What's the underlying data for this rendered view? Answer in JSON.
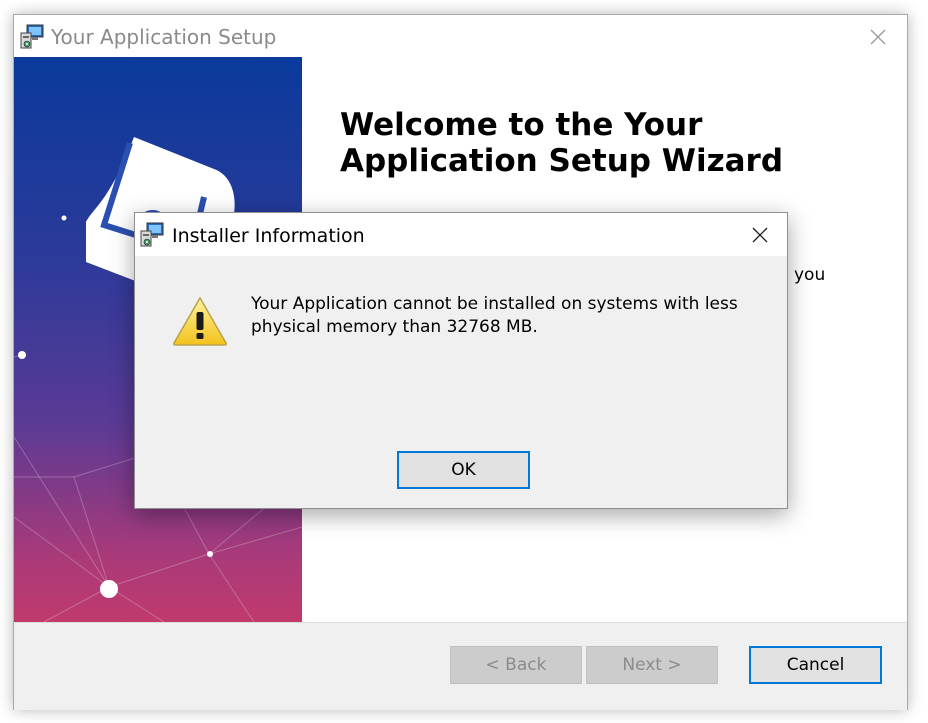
{
  "window": {
    "title": "Your Application Setup"
  },
  "main": {
    "welcome_title": "Welcome to the Your Application Setup Wizard",
    "partial_text": "you"
  },
  "buttons": {
    "back_label": "< Back",
    "next_label": "Next >",
    "cancel_label": "Cancel"
  },
  "dialog": {
    "title": "Installer Information",
    "message": "Your Application cannot be installed on systems with less physical memory than 32768 MB.",
    "ok_label": "OK"
  },
  "icons": {
    "window_icon": "installer-computer-icon",
    "window_close": "close-icon",
    "dialog_icon": "installer-computer-icon",
    "dialog_close": "close-icon",
    "warning": "warning-icon"
  },
  "colors": {
    "accent": "#0078d7",
    "banner_top": "#0a3a9c",
    "banner_bottom": "#c03a6c",
    "warning_yellow": "#f6d32a"
  }
}
